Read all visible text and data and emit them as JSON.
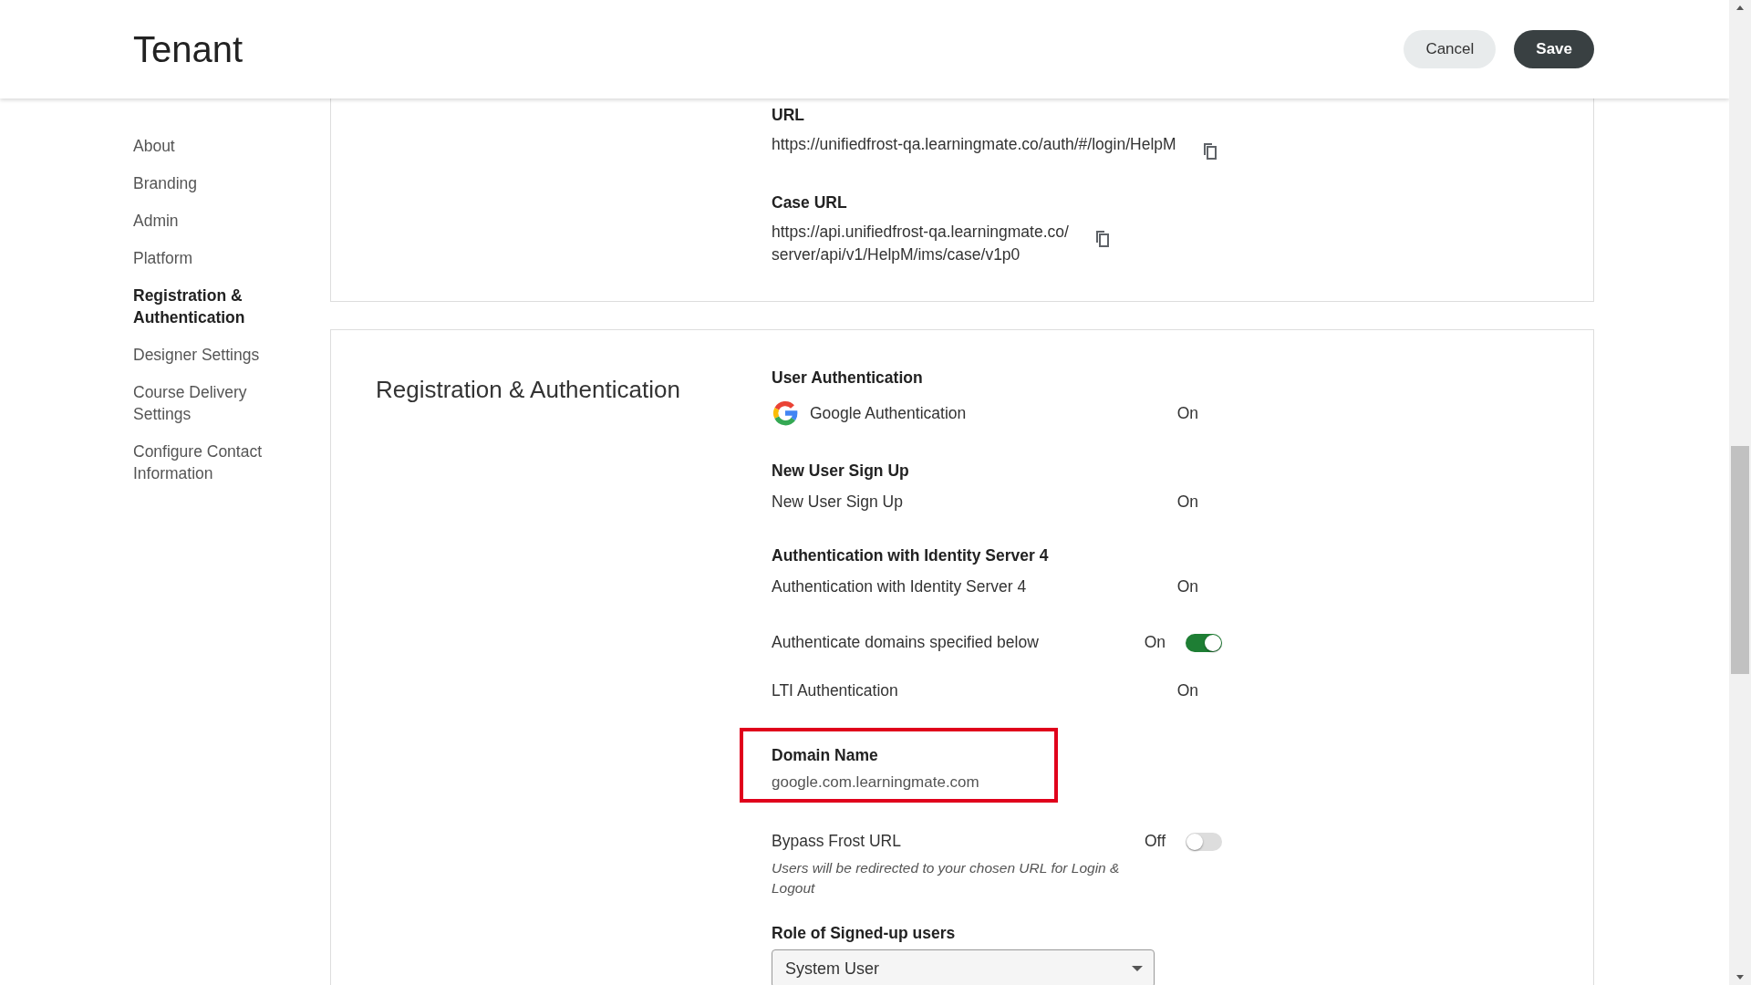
{
  "header": {
    "title": "Tenant",
    "buttons": [
      {
        "label": "Cancel",
        "kind": "secondary"
      },
      {
        "label": "Save",
        "kind": "primary"
      }
    ]
  },
  "sidebar": {
    "items": [
      {
        "label": "About",
        "selected": false
      },
      {
        "label": "Branding",
        "selected": false
      },
      {
        "label": "Admin",
        "selected": false
      },
      {
        "label": "Platform",
        "selected": false
      },
      {
        "label": "Registration & Authentication",
        "selected": true
      },
      {
        "label": "Designer Settings",
        "selected": false
      },
      {
        "label": "Course Delivery Settings",
        "selected": false
      },
      {
        "label": "Configure Contact Information",
        "selected": false
      }
    ]
  },
  "url_card": {
    "fields": [
      {
        "label": "URL",
        "value": "https://unifiedfrost-qa.learningmate.co/auth/#/login/HelpM"
      },
      {
        "label": "Case URL",
        "value": "https://api.unifiedfrost-qa.learningmate.co/\nserver/api/v1/HelpM/ims/case/v1p0"
      }
    ]
  },
  "registration": {
    "title": "Registration & Authentication",
    "rows": [
      {
        "kind": "heading",
        "text": "User Authentication"
      },
      {
        "kind": "status",
        "logo": true,
        "label": "Google Authentication",
        "value": "On"
      },
      {
        "kind": "heading",
        "text": "New User Sign Up"
      },
      {
        "kind": "status",
        "label": "New User Sign Up",
        "value": "On"
      },
      {
        "kind": "heading",
        "text": "Authentication with Identity Server 4"
      },
      {
        "kind": "status",
        "label": "Authentication with Identity Server 4",
        "value": "On"
      },
      {
        "kind": "toggle",
        "label": "Authenticate domains specified below",
        "value": "On",
        "on": true
      },
      {
        "kind": "status",
        "label": "LTI Authentication",
        "value": "On"
      },
      {
        "kind": "field",
        "label": "Domain Name",
        "value": "google.com.learningmate.com",
        "highlighted": true,
        "blurred": true
      },
      {
        "kind": "toggle",
        "label": "Bypass Frost URL",
        "value": "Off",
        "on": false,
        "hint": "Users will be redirected to your chosen URL for Login & Logout"
      },
      {
        "kind": "select",
        "label": "Role of Signed-up users",
        "value": "System User"
      }
    ]
  }
}
